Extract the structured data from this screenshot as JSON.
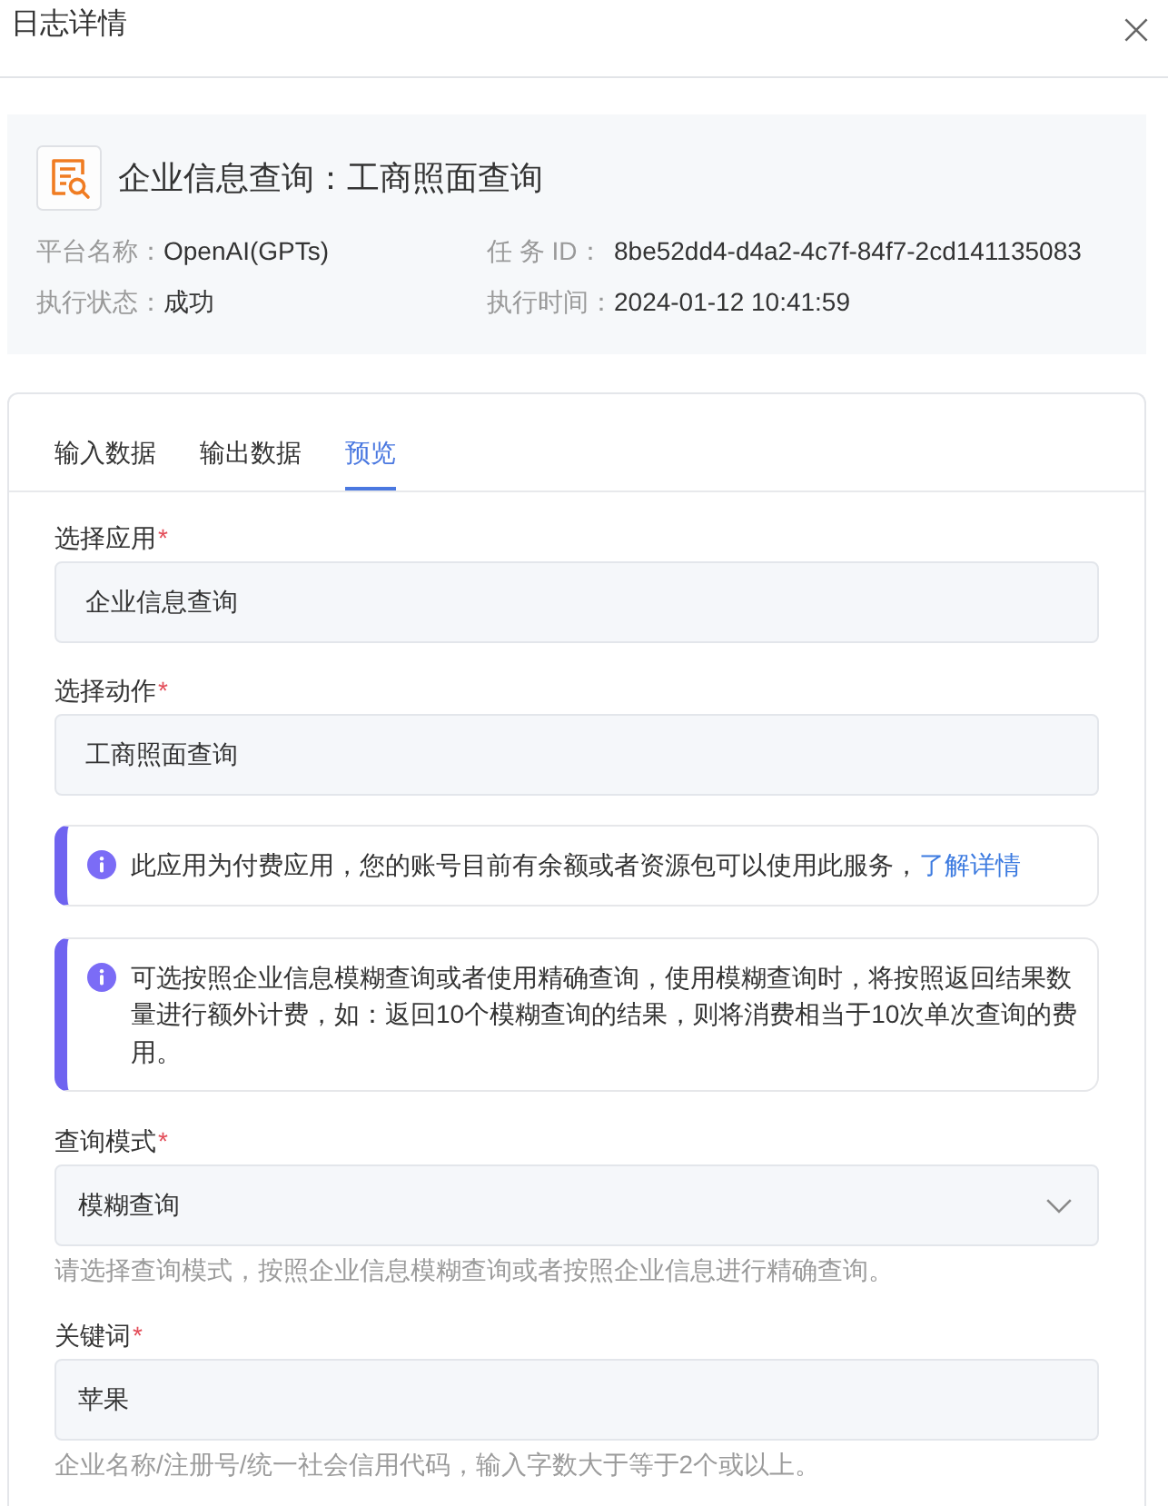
{
  "dialog": {
    "title": "日志详情"
  },
  "summary": {
    "title": "企业信息查询：工商照面查询",
    "fields": [
      {
        "label": "平台名称：",
        "value": "OpenAI(GPTs)"
      },
      {
        "label": "任 务 ID：",
        "value": "8be52dd4-d4a2-4c7f-84f7-2cd141135083"
      },
      {
        "label": "执行状态：",
        "value": "成功"
      },
      {
        "label": "执行时间：",
        "value": "2024-01-12 10:41:59"
      }
    ]
  },
  "tabs": [
    {
      "label": "输入数据",
      "selected": false
    },
    {
      "label": "输出数据",
      "selected": false
    },
    {
      "label": "预览",
      "selected": true
    }
  ],
  "form": [
    {
      "kind": "display",
      "label": "选择应用",
      "required_mark": "*",
      "value": "企业信息查询"
    },
    {
      "kind": "display",
      "label": "选择动作",
      "required_mark": "*",
      "value": "工商照面查询"
    },
    {
      "kind": "notice",
      "text": "此应用为付费应用，您的账号目前有余额或者资源包可以使用此服务，",
      "link": "了解详情"
    },
    {
      "kind": "notice",
      "text": "可选按照企业信息模糊查询或者使用精确查询，使用模糊查询时，将按照返回结果数量进行额外计费，如：返回10个模糊查询的结果，则将消费相当于10次单次查询的费用。"
    },
    {
      "kind": "select",
      "label": "查询模式",
      "required_mark": "*",
      "value": "模糊查询",
      "help": "请选择查询模式，按照企业信息模糊查询或者按照企业信息进行精确查询。"
    },
    {
      "kind": "input",
      "label": "关键词",
      "required_mark": "*",
      "value": "苹果",
      "help": "企业名称/注册号/统一社会信用代码，输入字数大于等于2个或以上。"
    }
  ]
}
